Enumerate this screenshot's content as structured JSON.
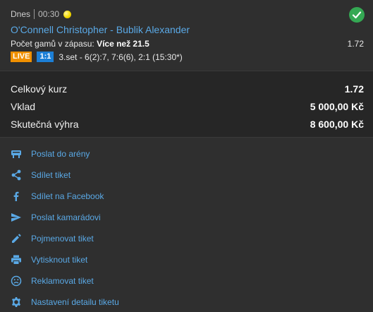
{
  "bet": {
    "date": "Dnes",
    "time": "00:30",
    "sport_icon": "tennis-ball-icon",
    "status_icon": "check-circle-icon",
    "match": "O'Connell Christopher - Bublik Alexander",
    "market_label": "Počet gamů v zápasu:",
    "market_value": "Více než 21.5",
    "odd": "1.72",
    "live_badge": "LIVE",
    "score_badge": "1:1",
    "score_detail": "3.set - 6(2):7, 7:6(6), 2:1 (15:30*)"
  },
  "summary": {
    "total_odds_label": "Celkový kurz",
    "total_odds_value": "1.72",
    "stake_label": "Vklad",
    "stake_value": "5 000,00 Kč",
    "win_label": "Skutečná výhra",
    "win_value": "8 600,00 Kč"
  },
  "actions": [
    {
      "label": "Poslat do arény",
      "icon": "arena-icon"
    },
    {
      "label": "Sdílet tiket",
      "icon": "share-icon"
    },
    {
      "label": "Sdílet na Facebook",
      "icon": "facebook-icon"
    },
    {
      "label": "Poslat kamarádovi",
      "icon": "send-icon"
    },
    {
      "label": "Pojmenovat tiket",
      "icon": "pencil-icon"
    },
    {
      "label": "Vytisknout tiket",
      "icon": "printer-icon"
    },
    {
      "label": "Reklamovat tiket",
      "icon": "sad-face-icon"
    },
    {
      "label": "Nastavení detailu tiketu",
      "icon": "gear-icon"
    }
  ],
  "colors": {
    "background": "#2f2f2f",
    "summary_background": "#262626",
    "link": "#5aa9e6",
    "live": "#f09000",
    "score": "#1c7fd6",
    "success": "#34a853"
  }
}
